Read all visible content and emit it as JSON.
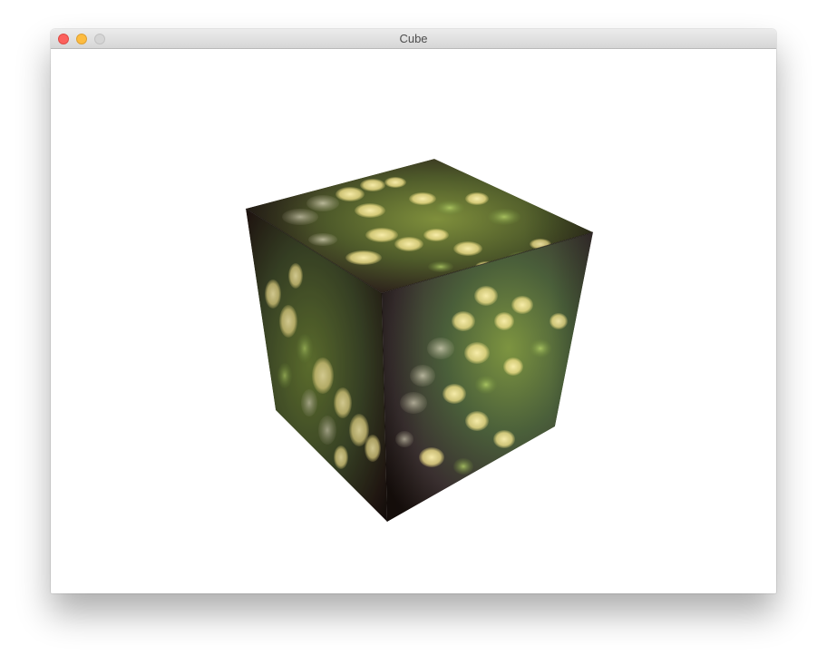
{
  "window": {
    "title": "Cube",
    "buttons": {
      "close": "close-button",
      "minimize": "minimize-button",
      "zoom": "zoom-button"
    }
  },
  "scene": {
    "object": "textured-cube",
    "texture": "bokeh",
    "colors": {
      "background": "#ffffff",
      "texture_dark": "#241812",
      "texture_green": "#6f8a3a",
      "texture_gold": "#e8d77a",
      "texture_teal": "#3e5a56"
    }
  }
}
